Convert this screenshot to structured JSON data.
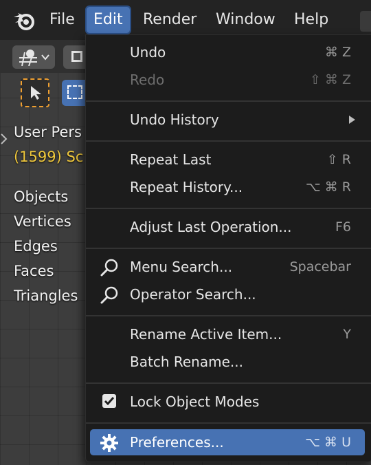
{
  "topbar": {
    "menus": [
      "File",
      "Edit",
      "Render",
      "Window",
      "Help"
    ],
    "active_menu": "Edit"
  },
  "viewport": {
    "view_name": "User Pers",
    "collection_info": "(1599) Sc",
    "stats": [
      "Objects",
      "Vertices",
      "Edges",
      "Faces",
      "Triangles"
    ]
  },
  "edit_menu": {
    "items": [
      {
        "label": "Undo",
        "shortcut": "⌘ Z"
      },
      {
        "label": "Redo",
        "shortcut": "⇧ ⌘ Z",
        "disabled": true
      },
      {
        "label": "Undo History",
        "submenu": true
      },
      {
        "label": "Repeat Last",
        "shortcut": "⇧ R"
      },
      {
        "label": "Repeat History...",
        "shortcut": "⌥ ⌘ R"
      },
      {
        "label": "Adjust Last Operation...",
        "shortcut": "F6"
      },
      {
        "label": "Menu Search...",
        "shortcut": "Spacebar",
        "icon": "search-icon"
      },
      {
        "label": "Operator Search...",
        "icon": "search-icon"
      },
      {
        "label": "Rename Active Item...",
        "shortcut": "Y"
      },
      {
        "label": "Batch Rename..."
      },
      {
        "label": "Lock Object Modes",
        "checked": true
      },
      {
        "label": "Preferences...",
        "shortcut": "⌥ ⌘ U",
        "icon": "gear-icon",
        "highlighted": true
      }
    ]
  },
  "colors": {
    "accent": "#4772b3",
    "menu_bg": "#1c1c1c",
    "topbar_bg": "#232323",
    "overlay_yellow": "#f0c83c"
  }
}
